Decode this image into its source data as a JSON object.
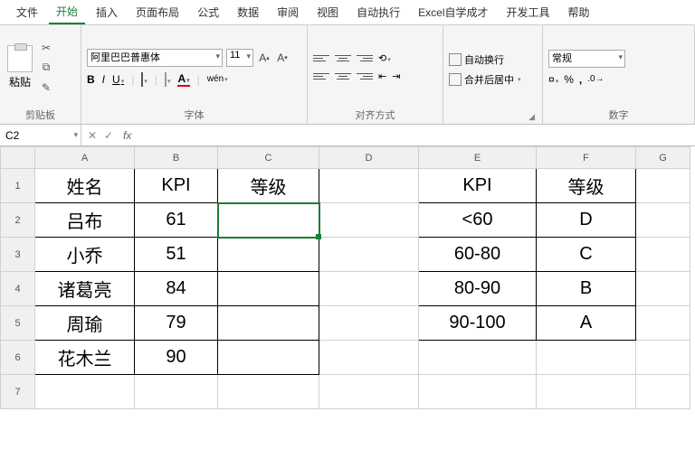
{
  "menu": {
    "items": [
      "文件",
      "开始",
      "插入",
      "页面布局",
      "公式",
      "数据",
      "审阅",
      "视图",
      "自动执行",
      "Excel自学成才",
      "开发工具",
      "帮助"
    ],
    "active_index": 1
  },
  "ribbon": {
    "clipboard": {
      "paste": "粘贴",
      "label": "剪贴板"
    },
    "font": {
      "name": "阿里巴巴普惠体",
      "size": "11",
      "bold": "B",
      "italic": "I",
      "underline": "U",
      "label": "字体"
    },
    "align": {
      "label": "对齐方式"
    },
    "wrap": {
      "wrap": "自动换行",
      "merge": "合并后居中",
      "label": ""
    },
    "number": {
      "format": "常规",
      "pct": "%",
      "comma": ",",
      "label": "数字"
    }
  },
  "groups_extra": {
    "wen": "wén",
    "Aup": "A",
    "Adown": "A",
    "curr": "%",
    "comm": ","
  },
  "formula_bar": {
    "cell_ref": "C2",
    "value": ""
  },
  "columns": [
    "A",
    "B",
    "C",
    "D",
    "E",
    "F",
    "G"
  ],
  "rows": [
    "1",
    "2",
    "3",
    "4",
    "5",
    "6",
    "7"
  ],
  "table_left": {
    "header": {
      "A": "姓名",
      "B": "KPI",
      "C": "等级"
    },
    "rows": [
      {
        "A": "吕布",
        "B": "61",
        "C": ""
      },
      {
        "A": "小乔",
        "B": "51",
        "C": ""
      },
      {
        "A": "诸葛亮",
        "B": "84",
        "C": ""
      },
      {
        "A": "周瑜",
        "B": "79",
        "C": ""
      },
      {
        "A": "花木兰",
        "B": "90",
        "C": ""
      }
    ]
  },
  "table_right": {
    "header": {
      "E": "KPI",
      "F": "等级"
    },
    "rows": [
      {
        "E": "<60",
        "F": "D"
      },
      {
        "E": "60-80",
        "F": "C"
      },
      {
        "E": "80-90",
        "F": "B"
      },
      {
        "E": "90-100",
        "F": "A"
      }
    ]
  },
  "selected_cell": "C2"
}
